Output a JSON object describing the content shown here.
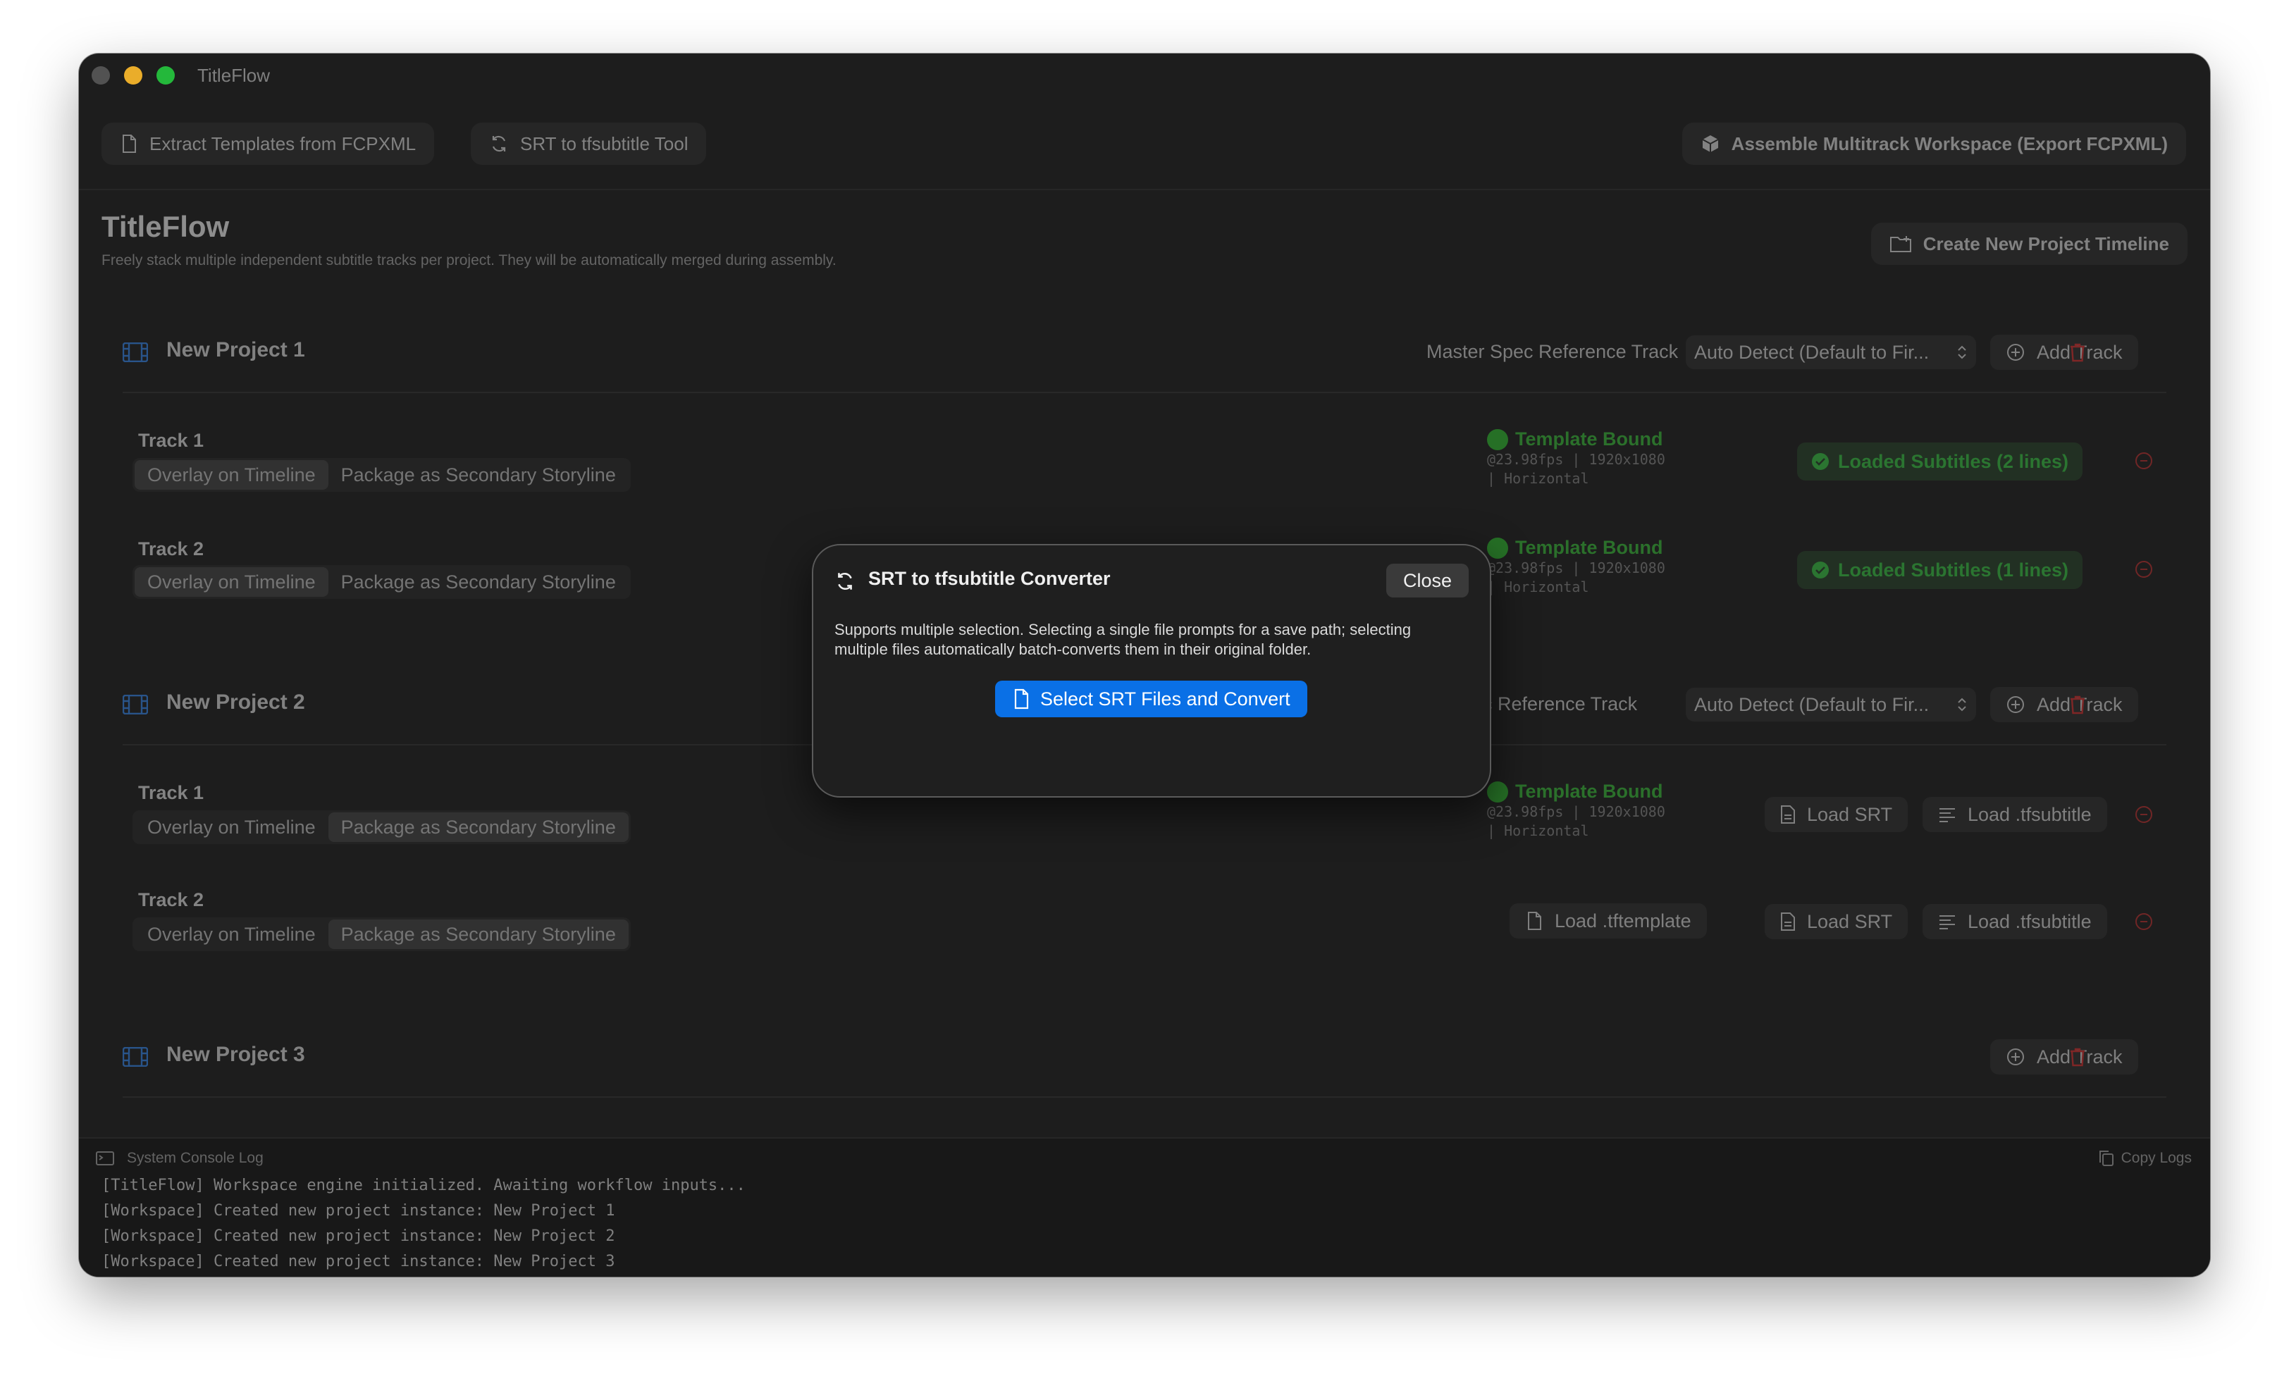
{
  "app_title": "TitleFlow",
  "toolbar": {
    "extract_label": "Extract Templates from FCPXML",
    "srt_tool_label": "SRT to tfsubtitle Tool",
    "assemble_label": "Assemble Multitrack Workspace (Export FCPXML)"
  },
  "header": {
    "title": "TitleFlow",
    "subtitle": "Freely stack multiple independent subtitle tracks per project. They will be automatically merged during assembly.",
    "create_label": "Create New Project Timeline"
  },
  "common": {
    "master_spec_label": "Master Spec Reference Track",
    "master_spec_label_partial": "Spec Reference Track",
    "auto_detect_value": "Auto Detect (Default to Fir...",
    "add_track_label": "Add Track",
    "overlay_label": "Overlay on Timeline",
    "package_label": "Package as Secondary Storyline",
    "template_bound": "Template Bound",
    "template_meta1": "@23.98fps | 1920x1080",
    "template_meta2": "| Horizontal",
    "load_srt": "Load SRT",
    "load_tfsubtitle": "Load .tfsubtitle",
    "load_tftemplate": "Load .tftemplate"
  },
  "projects": [
    {
      "name": "New Project 1",
      "tracks": [
        {
          "name": "Track 1",
          "loaded": "Loaded Subtitles (2 lines)"
        },
        {
          "name": "Track 2",
          "loaded": "Loaded Subtitles (1 lines)"
        }
      ]
    },
    {
      "name": "New Project 2",
      "tracks": [
        {
          "name": "Track 1"
        },
        {
          "name": "Track 2"
        }
      ]
    },
    {
      "name": "New Project 3"
    }
  ],
  "console": {
    "title": "System Console Log",
    "copy_label": "Copy Logs",
    "lines": [
      "[TitleFlow] Workspace engine initialized. Awaiting workflow inputs...",
      "[Workspace] Created new project instance: New Project 1",
      "[Workspace] Created new project instance: New Project 2",
      "[Workspace] Created new project instance: New Project 3"
    ]
  },
  "modal": {
    "title": "SRT to tfsubtitle Converter",
    "close_label": "Close",
    "description": "Supports multiple selection. Selecting a single file prompts for a save path; selecting multiple files automatically batch-converts them in their original folder.",
    "primary_label": "Select SRT Files and Convert"
  },
  "colors": {
    "accent_blue": "#0a70e6",
    "success_green": "#2f7a2f",
    "danger_red": "#7a2a2a"
  }
}
